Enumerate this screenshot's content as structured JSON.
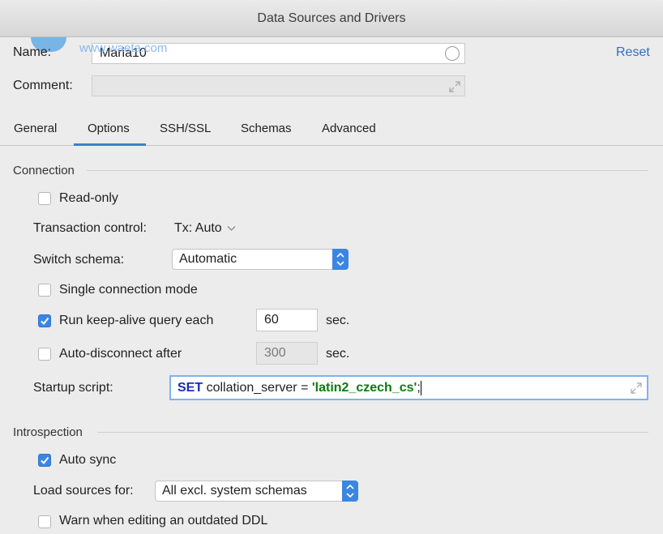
{
  "window": {
    "title": "Data Sources and Drivers"
  },
  "form": {
    "name_label": "Name:",
    "name_value": "Maria10",
    "comment_label": "Comment:",
    "comment_value": "",
    "reset_label": "Reset",
    "watermark_text": "www.waeta.com"
  },
  "tabs": [
    {
      "label": "General",
      "active": false
    },
    {
      "label": "Options",
      "active": true
    },
    {
      "label": "SSH/SSL",
      "active": false
    },
    {
      "label": "Schemas",
      "active": false
    },
    {
      "label": "Advanced",
      "active": false
    }
  ],
  "connection": {
    "section_title": "Connection",
    "read_only": {
      "label": "Read-only",
      "checked": false
    },
    "transaction_control": {
      "label": "Transaction control:",
      "value": "Tx: Auto"
    },
    "switch_schema": {
      "label": "Switch schema:",
      "value": "Automatic"
    },
    "single_connection": {
      "label": "Single connection mode",
      "checked": false
    },
    "keep_alive": {
      "label": "Run keep-alive query each",
      "checked": true,
      "value": "60",
      "unit": "sec."
    },
    "auto_disconnect": {
      "label": "Auto-disconnect after",
      "checked": false,
      "value": "300",
      "unit": "sec."
    },
    "startup_script": {
      "label": "Startup script:",
      "keyword": "SET",
      "middle": " collation_server = ",
      "string": "'latin2_czech_cs'",
      "end": ";"
    }
  },
  "introspection": {
    "section_title": "Introspection",
    "auto_sync": {
      "label": "Auto sync",
      "checked": true
    },
    "load_sources": {
      "label": "Load sources for:",
      "value": "All excl. system schemas"
    },
    "warn_outdated": {
      "label": "Warn when editing an outdated DDL",
      "checked": false
    }
  },
  "colors": {
    "accent": "#3b86e2",
    "keyword": "#1a2db5",
    "string": "#0c7a10",
    "link": "#2f6fcf"
  },
  "icons": {
    "checkmark": "checkmark-icon",
    "expand": "expand-icon",
    "chevron": "chevron-down-icon",
    "stepper": "up-down-stepper-icon",
    "clear": "circle-icon"
  }
}
